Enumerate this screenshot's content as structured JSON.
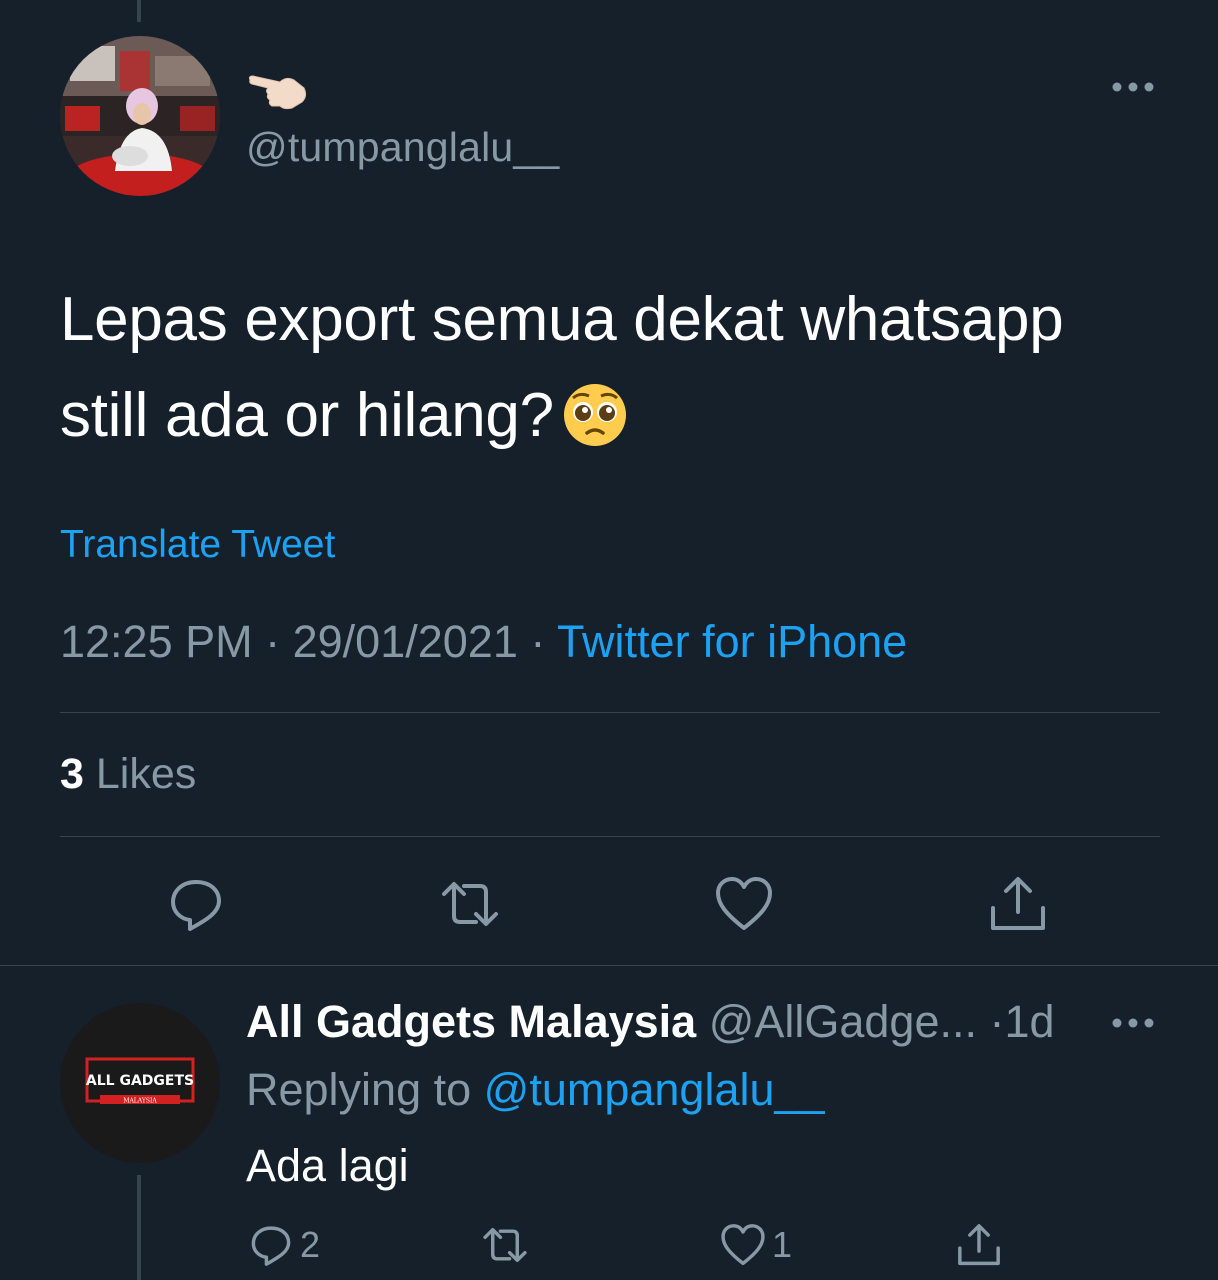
{
  "tweet": {
    "author_handle": "@tumpanglalu__",
    "name_icon": "pointing-hand-emoji",
    "text_line1": "Lepas export semua dekat whatsapp",
    "text_line2": "still ada or hilang?",
    "emoji": "pleading-face-emoji",
    "translate_label": "Translate Tweet",
    "time": "12:25 PM",
    "date": "29/01/2021",
    "separator": " · ",
    "source": "Twitter for iPhone",
    "likes_count": "3",
    "likes_label": " Likes"
  },
  "actions": [
    "reply-icon",
    "retweet-icon",
    "like-icon",
    "share-icon"
  ],
  "reply": {
    "author_name": "All Gadgets Malaysia",
    "author_handle": " @AllGadge...",
    "time": " ·1d",
    "replying_prefix": "Replying to ",
    "replying_to": "@tumpanglalu__",
    "text": "Ada lagi",
    "reply_count": "2",
    "like_count": "1",
    "avatar_text": "ALL GADGETS",
    "avatar_subtext": "MALAYSIA"
  },
  "colors": {
    "background": "#15202b",
    "accent": "#1da1f2",
    "secondary_text": "#8899a6",
    "divider": "#38444d"
  }
}
